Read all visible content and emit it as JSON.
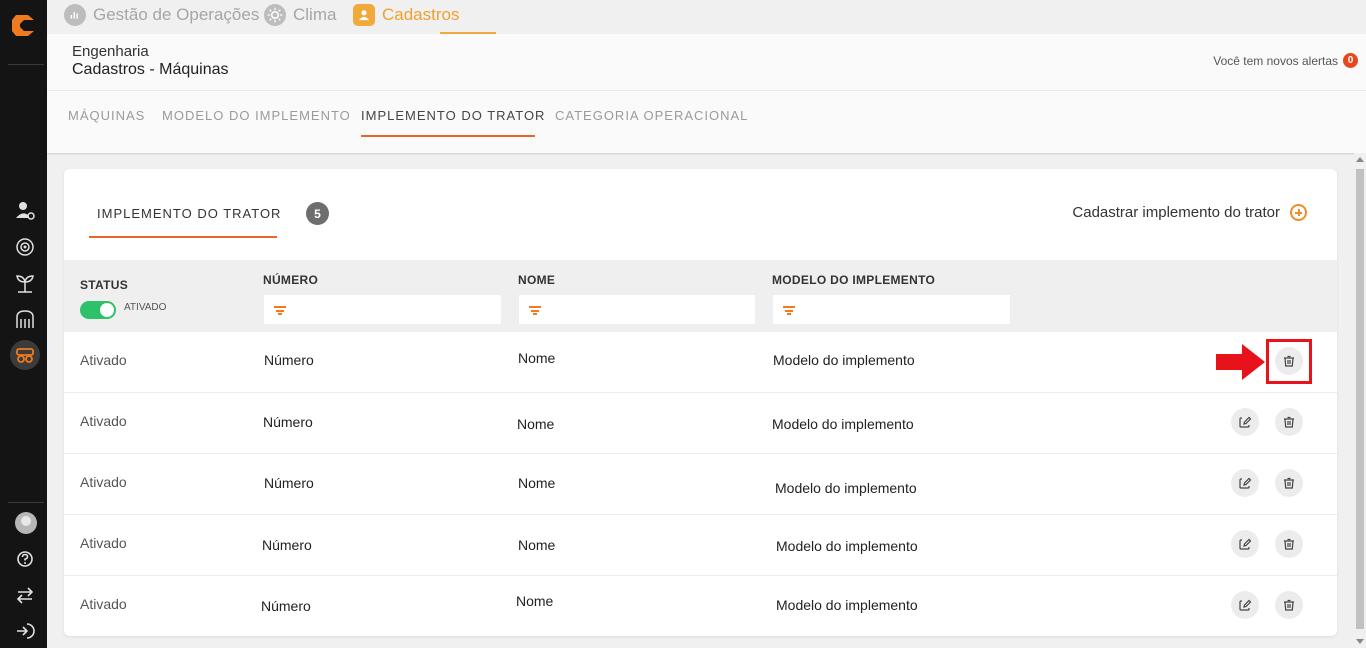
{
  "rail": {
    "logo_color": "#f07a1e",
    "icons": [
      "user-gear-icon",
      "target-icon",
      "plant-icon",
      "silo-icon",
      "tractor-icon",
      "help-icon",
      "switch-icon",
      "logout-icon"
    ]
  },
  "topbar": {
    "modules": [
      {
        "label": "Gestão de Operações",
        "icon": "chart-icon"
      },
      {
        "label": "Clima",
        "icon": "sun-icon"
      },
      {
        "label": "Cadastros",
        "icon": "user-icon"
      }
    ]
  },
  "header": {
    "breadcrumb_parent": "Engenharia",
    "breadcrumb_current": "Cadastros - Máquinas",
    "alerts_text": "Você tem novos alertas",
    "alerts_count": "0"
  },
  "subtabs": [
    {
      "label": "MÁQUINAS"
    },
    {
      "label": "MODELO DO IMPLEMENTO"
    },
    {
      "label": "IMPLEMENTO DO TRATOR"
    },
    {
      "label": "CATEGORIA OPERACIONAL"
    }
  ],
  "card": {
    "tab_label": "IMPLEMENTO DO TRATOR",
    "count": "5",
    "register_label": "Cadastrar implemento do trator"
  },
  "table": {
    "headers": {
      "status": "STATUS",
      "numero": "NÚMERO",
      "nome": "NOME",
      "modelo": "MODELO DO IMPLEMENTO"
    },
    "status_filter_label": "ATIVADO",
    "rows": [
      {
        "status": "Ativado",
        "numero": "Número",
        "nome": "Nome",
        "modelo": "Modelo do implemento"
      },
      {
        "status": "Ativado",
        "numero": "Número",
        "nome": "Nome",
        "modelo": "Modelo do implemento"
      },
      {
        "status": "Ativado",
        "numero": "Número",
        "nome": "Nome",
        "modelo": "Modelo do implemento"
      },
      {
        "status": "Ativado",
        "numero": "Número",
        "nome": "Nome",
        "modelo": "Modelo do implemento"
      },
      {
        "status": "Ativado",
        "numero": "Número",
        "nome": "Nome",
        "modelo": "Modelo do implemento"
      }
    ]
  },
  "colors": {
    "accent": "#e8662a",
    "module_active": "#f2a93b",
    "toggle_on": "#2dc26a",
    "highlight": "#e8121b"
  }
}
